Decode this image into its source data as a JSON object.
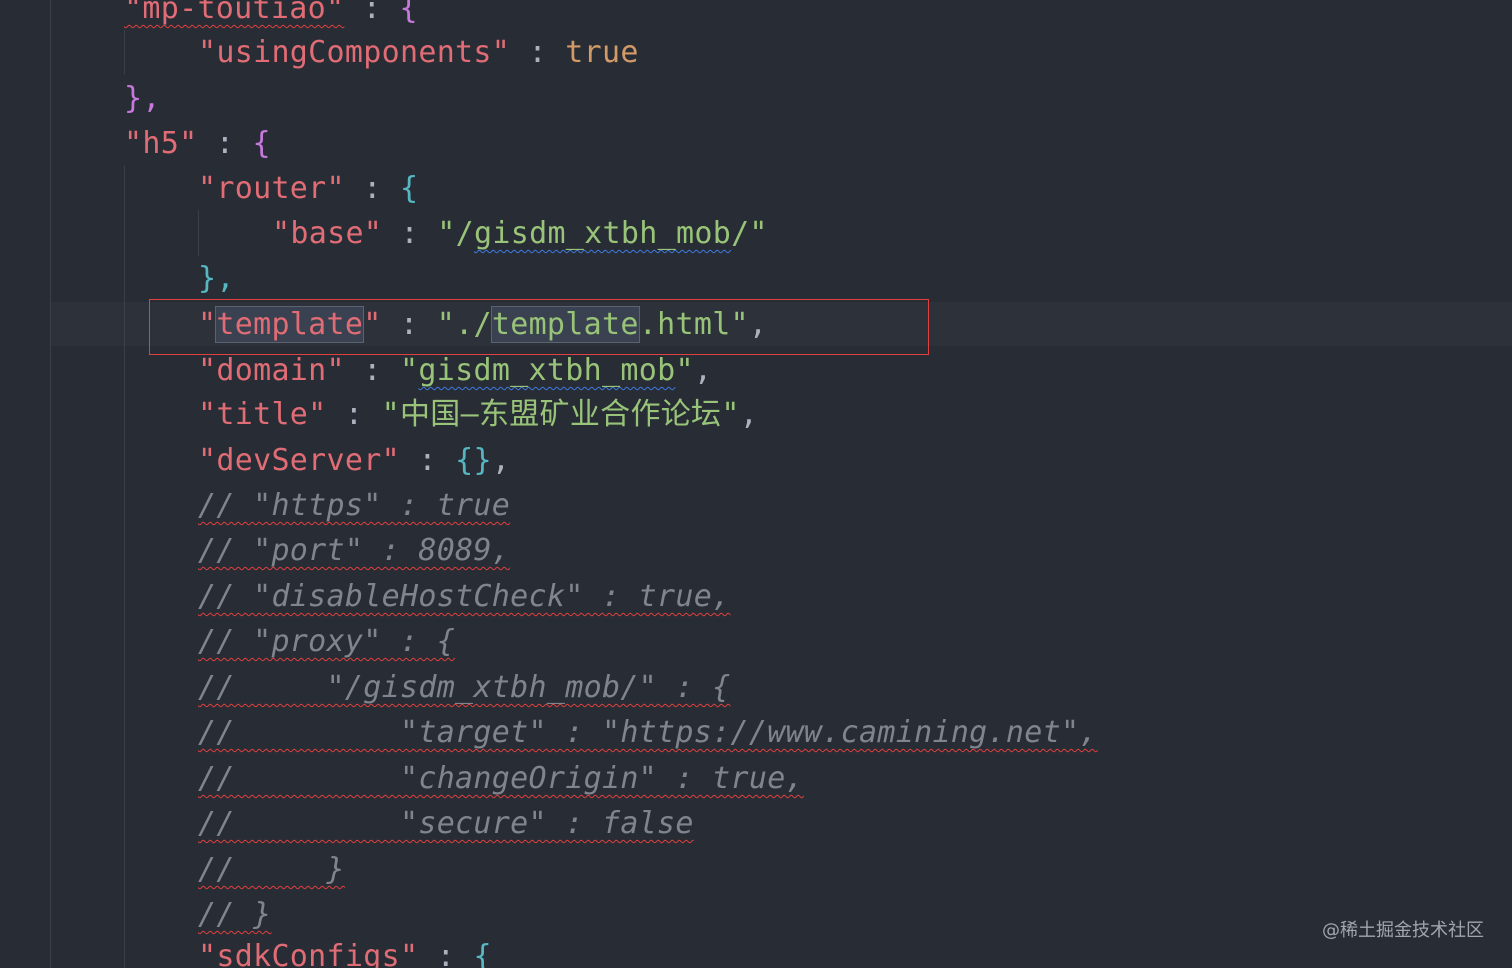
{
  "code": {
    "l0_key": "\"mp-toutiao\"",
    "l0_sep": " : ",
    "l0_brace": "{",
    "l1_key": "\"usingComponents\"",
    "l1_sep": " : ",
    "l1_val": "true",
    "l2_close": "},",
    "l3_key": "\"h5\"",
    "l3_sep": " : ",
    "l3_brace": "{",
    "l4_key": "\"router\"",
    "l4_sep": " : ",
    "l4_brace": "{",
    "l5_key": "\"base\"",
    "l5_sep": " : ",
    "l5_val_q1": "\"/",
    "l5_val_word": "gisdm_xtbh_mob",
    "l5_val_q2": "/\"",
    "l6_close": "},",
    "l7_q1": "\"",
    "l7_key_word": "template",
    "l7_q2": "\"",
    "l7_sep": " : ",
    "l7_val_a": "\"./",
    "l7_val_word": "template",
    "l7_val_b": ".html\"",
    "l7_comma": ",",
    "l8_key": "\"domain\"",
    "l8_sep": " : ",
    "l8_val_q1": "\"",
    "l8_val_word": "gisdm_xtbh_mob",
    "l8_val_q2": "\"",
    "l8_comma": ",",
    "l9_key": "\"title\"",
    "l9_sep": " : ",
    "l9_val": "\"中国—东盟矿业合作论坛\"",
    "l9_comma": ",",
    "l10_key": "\"devServer\"",
    "l10_sep": " : ",
    "l10_val": "{}",
    "l10_comma": ",",
    "c1": "// \"https\" : true",
    "c2": "// \"port\" : 8089,",
    "c3": "// \"disableHostCheck\" : true,",
    "c4": "// \"proxy\" : {",
    "c5": "//     \"/gisdm_xtbh_mob/\" : {",
    "c6": "//         \"target\" : \"https://www.camining.net\",",
    "c7": "//         \"changeOrigin\" : true,",
    "c8": "//         \"secure\" : false",
    "c9": "//     }",
    "c10": "// }",
    "l21_key": "\"sdkConfigs\"",
    "l21_sep": " : ",
    "l21_brace": "{"
  },
  "watermark": "@稀土掘金技术社区",
  "colors": {
    "background": "#282c34",
    "key": "#e06c75",
    "string": "#98c379",
    "boolean": "#d19a66",
    "comment": "#7f848e",
    "highlight_box": "#e0403f"
  }
}
